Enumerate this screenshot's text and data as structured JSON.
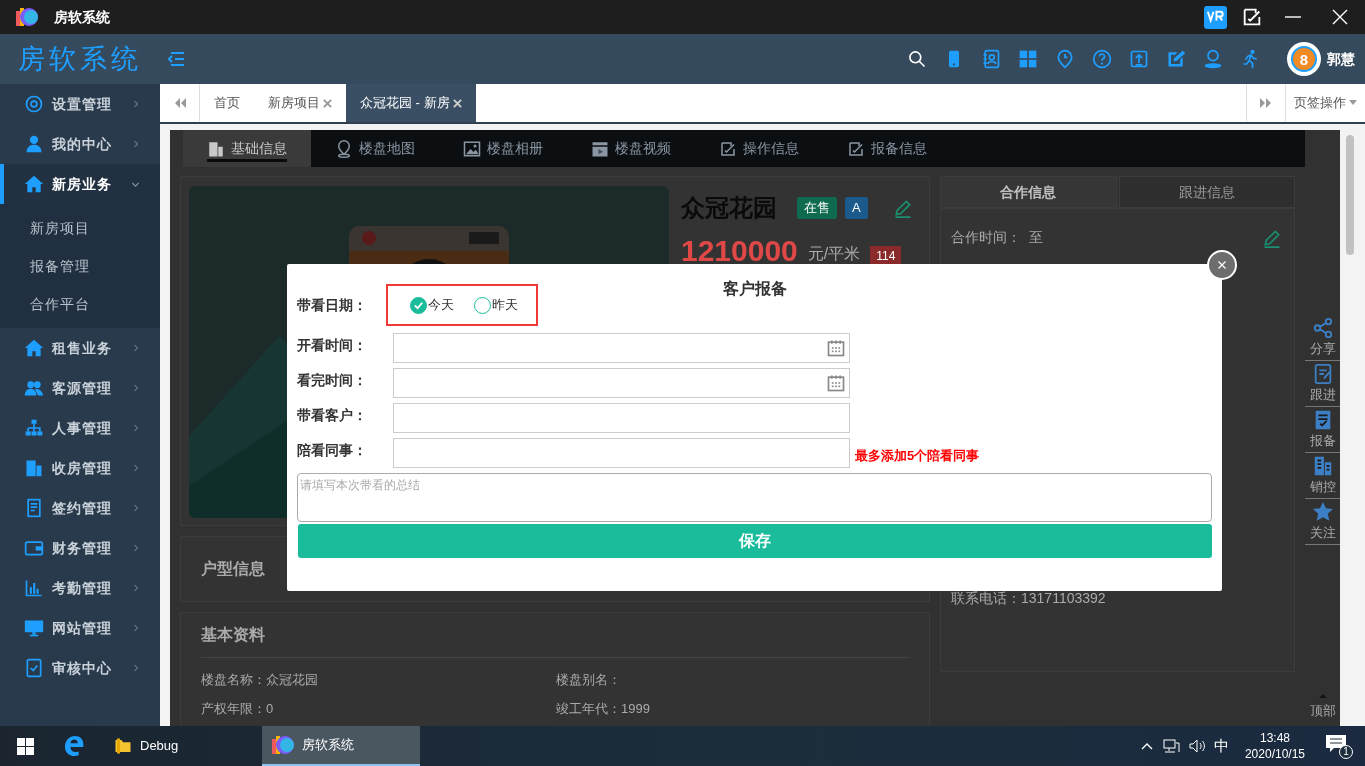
{
  "window": {
    "title": "房软系统"
  },
  "header": {
    "brand": "房软系统",
    "user": {
      "name": "郭慧",
      "badge": "8"
    }
  },
  "sidebar": {
    "items": [
      {
        "label": "设置管理",
        "expanded": false,
        "selected": false
      },
      {
        "label": "我的中心",
        "expanded": false,
        "selected": false
      },
      {
        "label": "新房业务",
        "expanded": true,
        "selected": true,
        "children": [
          {
            "label": "新房项目"
          },
          {
            "label": "报备管理"
          },
          {
            "label": "合作平台"
          }
        ]
      },
      {
        "label": "租售业务",
        "expanded": false,
        "selected": false
      },
      {
        "label": "客源管理",
        "expanded": false,
        "selected": false
      },
      {
        "label": "人事管理",
        "expanded": false,
        "selected": false
      },
      {
        "label": "收房管理",
        "expanded": false,
        "selected": false
      },
      {
        "label": "签约管理",
        "expanded": false,
        "selected": false
      },
      {
        "label": "财务管理",
        "expanded": false,
        "selected": false
      },
      {
        "label": "考勤管理",
        "expanded": false,
        "selected": false
      },
      {
        "label": "网站管理",
        "expanded": false,
        "selected": false
      },
      {
        "label": "审核中心",
        "expanded": false,
        "selected": false
      }
    ]
  },
  "page_tabs": {
    "items": [
      {
        "label": "首页",
        "closable": false,
        "selected": false
      },
      {
        "label": "新房项目",
        "closable": true,
        "selected": false
      },
      {
        "label": "众冠花园 - 新房",
        "closable": true,
        "selected": true
      }
    ],
    "menu": "页签操作"
  },
  "project": {
    "tabs": [
      {
        "label": "基础信息",
        "selected": true
      },
      {
        "label": "楼盘地图",
        "selected": false
      },
      {
        "label": "楼盘相册",
        "selected": false
      },
      {
        "label": "楼盘视频",
        "selected": false
      },
      {
        "label": "操作信息",
        "selected": false
      },
      {
        "label": "报备信息",
        "selected": false
      }
    ],
    "name": "众冠花园",
    "badges": [
      {
        "text": "在售",
        "color": "#0f6b4f"
      },
      {
        "text": "A",
        "color": "#1d5a8c"
      }
    ],
    "price": "1210000",
    "unit": "元/平米",
    "price_badge": "114",
    "side_tabs": [
      {
        "label": "合作信息",
        "selected": true
      },
      {
        "label": "跟进信息",
        "selected": false
      }
    ],
    "coop_time_label": "合作时间：",
    "coop_time_value": "至",
    "phone": "联系电话：13171103392",
    "house_type_title": "户型信息",
    "basic_title": "基本资料",
    "basic_fields": [
      "楼盘名称：众冠花园",
      "楼盘别名：",
      "产权年限：0",
      "竣工年代：1999"
    ]
  },
  "float_tools": [
    {
      "label": "分享"
    },
    {
      "label": "跟进"
    },
    {
      "label": "报备"
    },
    {
      "label": "销控"
    },
    {
      "label": "关注"
    }
  ],
  "back_top": "顶部",
  "modal": {
    "title": "客户报备",
    "date": {
      "label": "带看日期：",
      "highlighted": true,
      "options": [
        {
          "label": "今天",
          "selected": true
        },
        {
          "label": "昨天",
          "selected": false
        }
      ]
    },
    "fields": [
      {
        "label": "开看时间：",
        "kind": "date"
      },
      {
        "label": "看完时间：",
        "kind": "date"
      },
      {
        "label": "带看客户：",
        "kind": "text"
      },
      {
        "label": "陪看同事：",
        "kind": "text",
        "hint": "最多添加5个陪看同事"
      }
    ],
    "summary": {
      "placeholder": "请填写本次带看的总结"
    },
    "save": "保存"
  },
  "taskbar": {
    "items": [
      {
        "label": "Debug",
        "selected": false
      },
      {
        "label": "房软系统",
        "selected": true
      }
    ],
    "ime": "中",
    "time": "13:48",
    "date": "2020/10/15",
    "notifications": "1"
  }
}
